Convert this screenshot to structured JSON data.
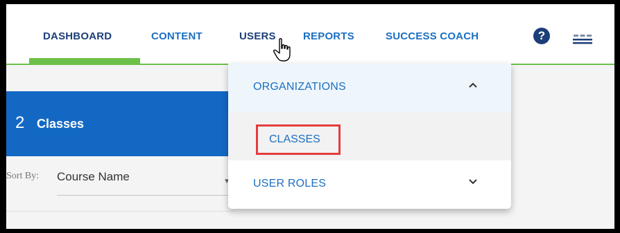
{
  "nav": {
    "items": [
      {
        "label": "DASHBOARD"
      },
      {
        "label": "CONTENT"
      },
      {
        "label": "USERS"
      },
      {
        "label": "REPORTS"
      },
      {
        "label": "SUCCESS COACH"
      }
    ],
    "active": "DASHBOARD",
    "hovered": "USERS",
    "help_glyph": "?",
    "icons": [
      "help-icon",
      "organization-icon"
    ]
  },
  "users_menu": {
    "items": [
      {
        "label": "ORGANIZATIONS",
        "state": "expanded"
      },
      {
        "label": "CLASSES",
        "state": "highlighted"
      },
      {
        "label": "USER ROLES",
        "state": "collapsed"
      }
    ]
  },
  "classes_panel": {
    "count": "2",
    "label": "Classes",
    "sort_label": "Sort By:",
    "sort_value": "Course Name"
  },
  "colors": {
    "nav_active": "#1c3f79",
    "nav_link": "#1b6fc1",
    "accent_green": "#6cc04a",
    "panel_blue": "#1368c4",
    "highlight_red": "#e53c3c"
  }
}
